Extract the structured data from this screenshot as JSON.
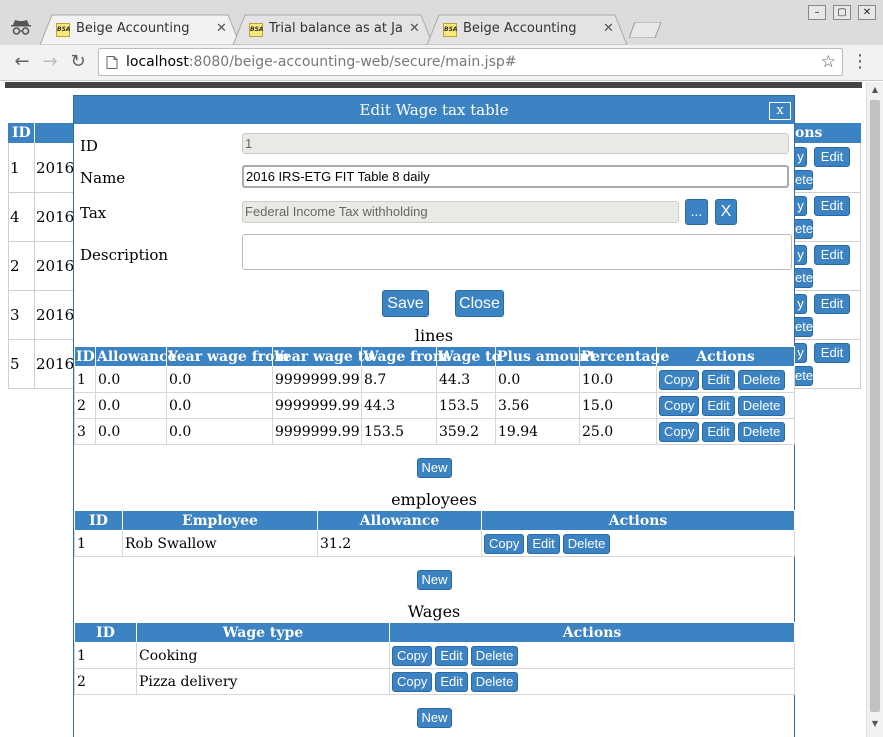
{
  "browser": {
    "tabs": [
      {
        "favicon": "BSA",
        "title": "Beige Accounting",
        "active": true
      },
      {
        "favicon": "BSA",
        "title": "Trial balance as at Jan",
        "active": false
      },
      {
        "favicon": "BSA",
        "title": "Beige Accounting",
        "active": false
      }
    ],
    "url_host": "localhost",
    "url_rest": ":8080/beige-accounting-web/secure/main.jsp#",
    "window_buttons": [
      "–",
      "▢",
      "✕"
    ]
  },
  "background": {
    "header_id": "ID",
    "header_actions": "ons",
    "rows": [
      {
        "id": "1",
        "name": "2016"
      },
      {
        "id": "4",
        "name": "2016"
      },
      {
        "id": "2",
        "name": "2016"
      },
      {
        "id": "3",
        "name": "2016"
      },
      {
        "id": "5",
        "name": "2016"
      }
    ],
    "copy_partial": "y",
    "edit_label": "Edit",
    "delete_partial": "ete"
  },
  "dialog": {
    "title": "Edit Wage tax table",
    "close_label": "x",
    "id_label": "ID",
    "id_value": "1",
    "name_label": "Name",
    "name_value": "2016 IRS-ETG FIT Table 8 daily",
    "tax_label": "Tax",
    "tax_value": "Federal Income Tax withholding",
    "tax_pick_label": "...",
    "tax_clear_label": "X",
    "description_label": "Description",
    "description_value": "",
    "save_label": "Save",
    "close_button_label": "Close",
    "lines": {
      "title": "lines",
      "headers": [
        "ID",
        "Allowance",
        "Year wage from",
        "Year wage to",
        "Wage from",
        "Wage to",
        "Plus amount",
        "Percentage",
        "Actions"
      ],
      "rows": [
        [
          "1",
          "0.0",
          "0.0",
          "9999999.99",
          "8.7",
          "44.3",
          "0.0",
          "10.0"
        ],
        [
          "2",
          "0.0",
          "0.0",
          "9999999.99",
          "44.3",
          "153.5",
          "3.56",
          "15.0"
        ],
        [
          "3",
          "0.0",
          "0.0",
          "9999999.99",
          "153.5",
          "359.2",
          "19.94",
          "25.0"
        ]
      ],
      "new_label": "New"
    },
    "employees": {
      "title": "employees",
      "headers": [
        "ID",
        "Employee",
        "Allowance",
        "Actions"
      ],
      "rows": [
        [
          "1",
          "Rob Swallow",
          "31.2"
        ]
      ],
      "new_label": "New"
    },
    "wages": {
      "title": "Wages",
      "headers": [
        "ID",
        "Wage type",
        "Actions"
      ],
      "rows": [
        [
          "1",
          "Cooking"
        ],
        [
          "2",
          "Pizza delivery"
        ]
      ],
      "new_label": "New"
    },
    "action_labels": {
      "copy": "Copy",
      "edit": "Edit",
      "delete": "Delete"
    }
  },
  "colors": {
    "accent": "#3c83c4",
    "header_text": "#ffffff",
    "readonly_bg": "#eaeae4"
  }
}
